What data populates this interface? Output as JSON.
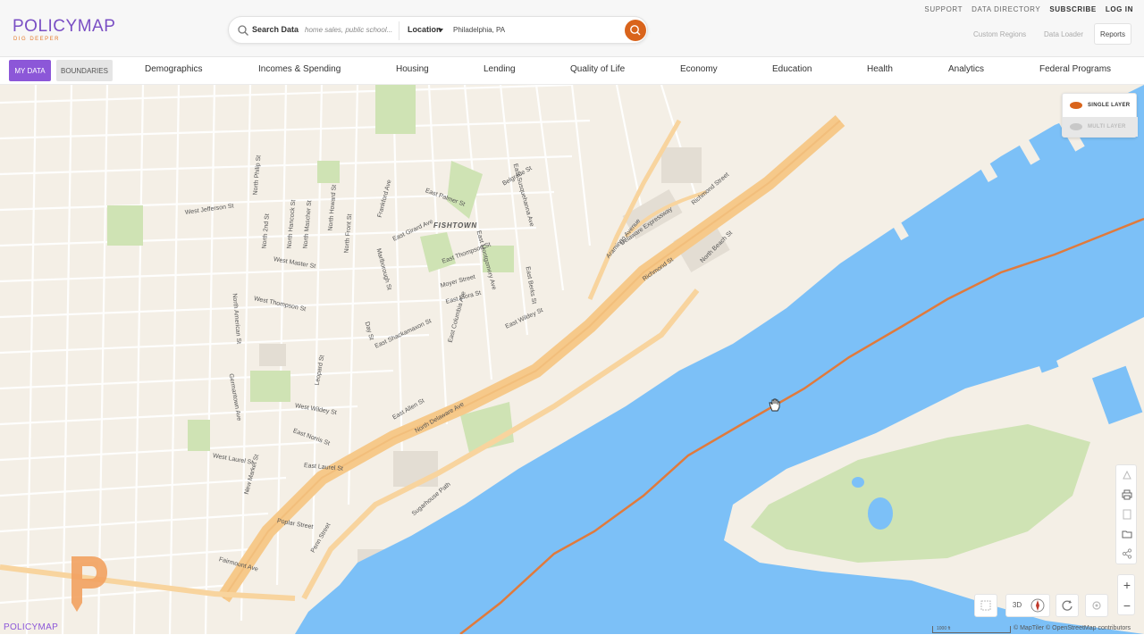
{
  "header": {
    "logo_text": "POLICYMAP",
    "logo_tagline": "DIG DEEPER",
    "search": {
      "label": "Search Data",
      "placeholder": "home sales, public school...",
      "location_label": "Location",
      "location_value": "Philadelphia, PA"
    },
    "top_links": [
      "SUPPORT",
      "DATA DIRECTORY",
      "SUBSCRIBE",
      "LOG IN"
    ],
    "custom_regions": "Custom Regions",
    "data_loader": "Data Loader",
    "reports": "Reports"
  },
  "nav": {
    "my_data": "MY DATA",
    "boundaries": "BOUNDARIES",
    "items": [
      "Demographics",
      "Incomes & Spending",
      "Housing",
      "Lending",
      "Quality of Life",
      "Economy",
      "Education",
      "Health",
      "Analytics",
      "Federal Programs"
    ]
  },
  "map": {
    "layer_single": "SINGLE LAYER",
    "layer_multi": "MULTI LAYER",
    "place": "FISHTOWN",
    "streets": [
      "West Jefferson St",
      "North Philip St",
      "North 2nd St",
      "North Hancock St",
      "North Mascher St",
      "North Howard St",
      "North Front St",
      "North American St",
      "West Master St",
      "Frankford Ave",
      "East Palmer St",
      "Belgrade St",
      "East Girard Ave",
      "Marlborough St",
      "East Thompson St",
      "Moyer Street",
      "East Flora St",
      "East Wildey St",
      "East Columbia Ave",
      "West Thompson St",
      "Delaware Expressway",
      "Richmond Street",
      "North Beach St",
      "North Delaware Ave",
      "East Allen St",
      "West Laurel St",
      "East Laurel St",
      "Fairmount Ave",
      "Poplar Street",
      "Penn Street",
      "Sugarhouse Path",
      "Aramingo Avenue",
      "Richmond St",
      "East Berks St",
      "Day St",
      "Leopard St",
      "Germantown Ave",
      "New Market St",
      "East Norris St",
      "West Wildey St",
      "East Shackamaxon St",
      "East Montgomery Ave",
      "East Susquehanna Ave"
    ],
    "bottom_3d": "3D",
    "zoom_in": "+",
    "zoom_out": "−",
    "scale": "1000 ft",
    "attribution": "© MapTiler © OpenStreetMap contributors"
  },
  "watermark": "POLICYMAP",
  "colors": {
    "brand_purple": "#8c57d8",
    "brand_orange": "#e57b2c",
    "water": "#7cc0f7",
    "land": "#f4efe6",
    "highway": "#f6c98a",
    "park": "#cfe3b4",
    "state_line": "#e07a3c"
  },
  "icons": [
    "search-icon",
    "caret-down-icon",
    "layer-icon",
    "print-icon",
    "share-icon",
    "folder-icon",
    "compass-icon",
    "refresh-icon",
    "settings-icon",
    "hand-cursor-icon"
  ]
}
